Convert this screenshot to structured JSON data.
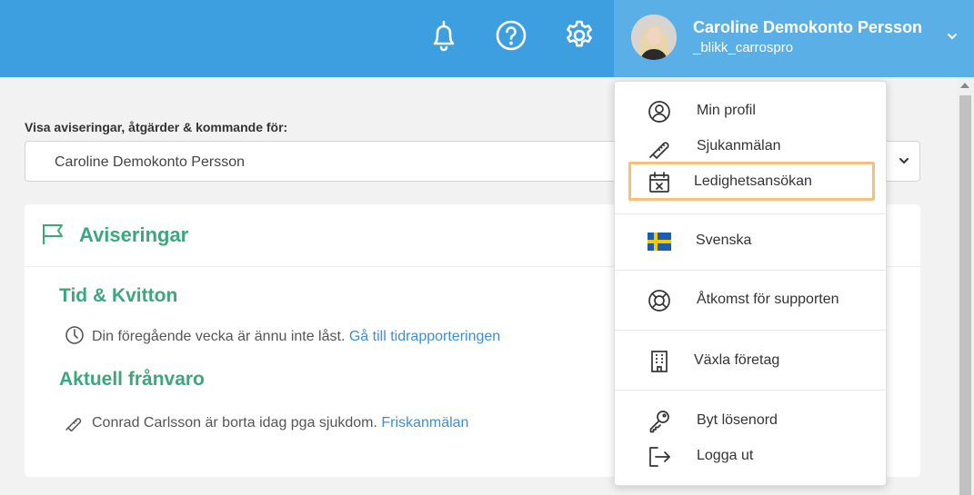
{
  "header": {
    "icons": [
      "bell-icon",
      "help-icon",
      "gear-icon"
    ],
    "user": {
      "name": "Caroline Demokonto Persson",
      "handle": "_blikk_carrospro"
    }
  },
  "filter": {
    "label": "Visa aviseringar, åtgärder & kommande för:",
    "selected": "Caroline Demokonto Persson"
  },
  "card": {
    "title": "Aviseringar",
    "sections": [
      {
        "title": "Tid & Kvitton",
        "text": "Din föregående vecka är ännu inte låst.",
        "link": "Gå till tidrapporteringen"
      },
      {
        "title": "Aktuell frånvaro",
        "text": "Conrad Carlsson är borta idag pga sjukdom.",
        "link": "Friskanmälan"
      }
    ]
  },
  "menu": {
    "items": [
      {
        "label": "Min profil",
        "icon": "user-circle-icon"
      },
      {
        "label": "Sjukanmälan",
        "icon": "thermometer-icon"
      },
      {
        "label": "Ledighetsansökan",
        "icon": "calendar-x-icon"
      },
      {
        "label": "Svenska",
        "icon": "swedish-flag-icon"
      },
      {
        "label": "Åtkomst för supporten",
        "icon": "lifebuoy-icon"
      },
      {
        "label": "Växla företag",
        "icon": "building-icon"
      },
      {
        "label": "Byt lösenord",
        "icon": "key-icon"
      },
      {
        "label": "Logga ut",
        "icon": "logout-icon"
      }
    ]
  },
  "colors": {
    "header": "#3d9fdf",
    "accent_green": "#3aa87a",
    "link": "#3d8fcf",
    "highlight": "#f5c07a",
    "flag_blue": "#1a5eb0",
    "flag_yellow": "#f9c800"
  }
}
